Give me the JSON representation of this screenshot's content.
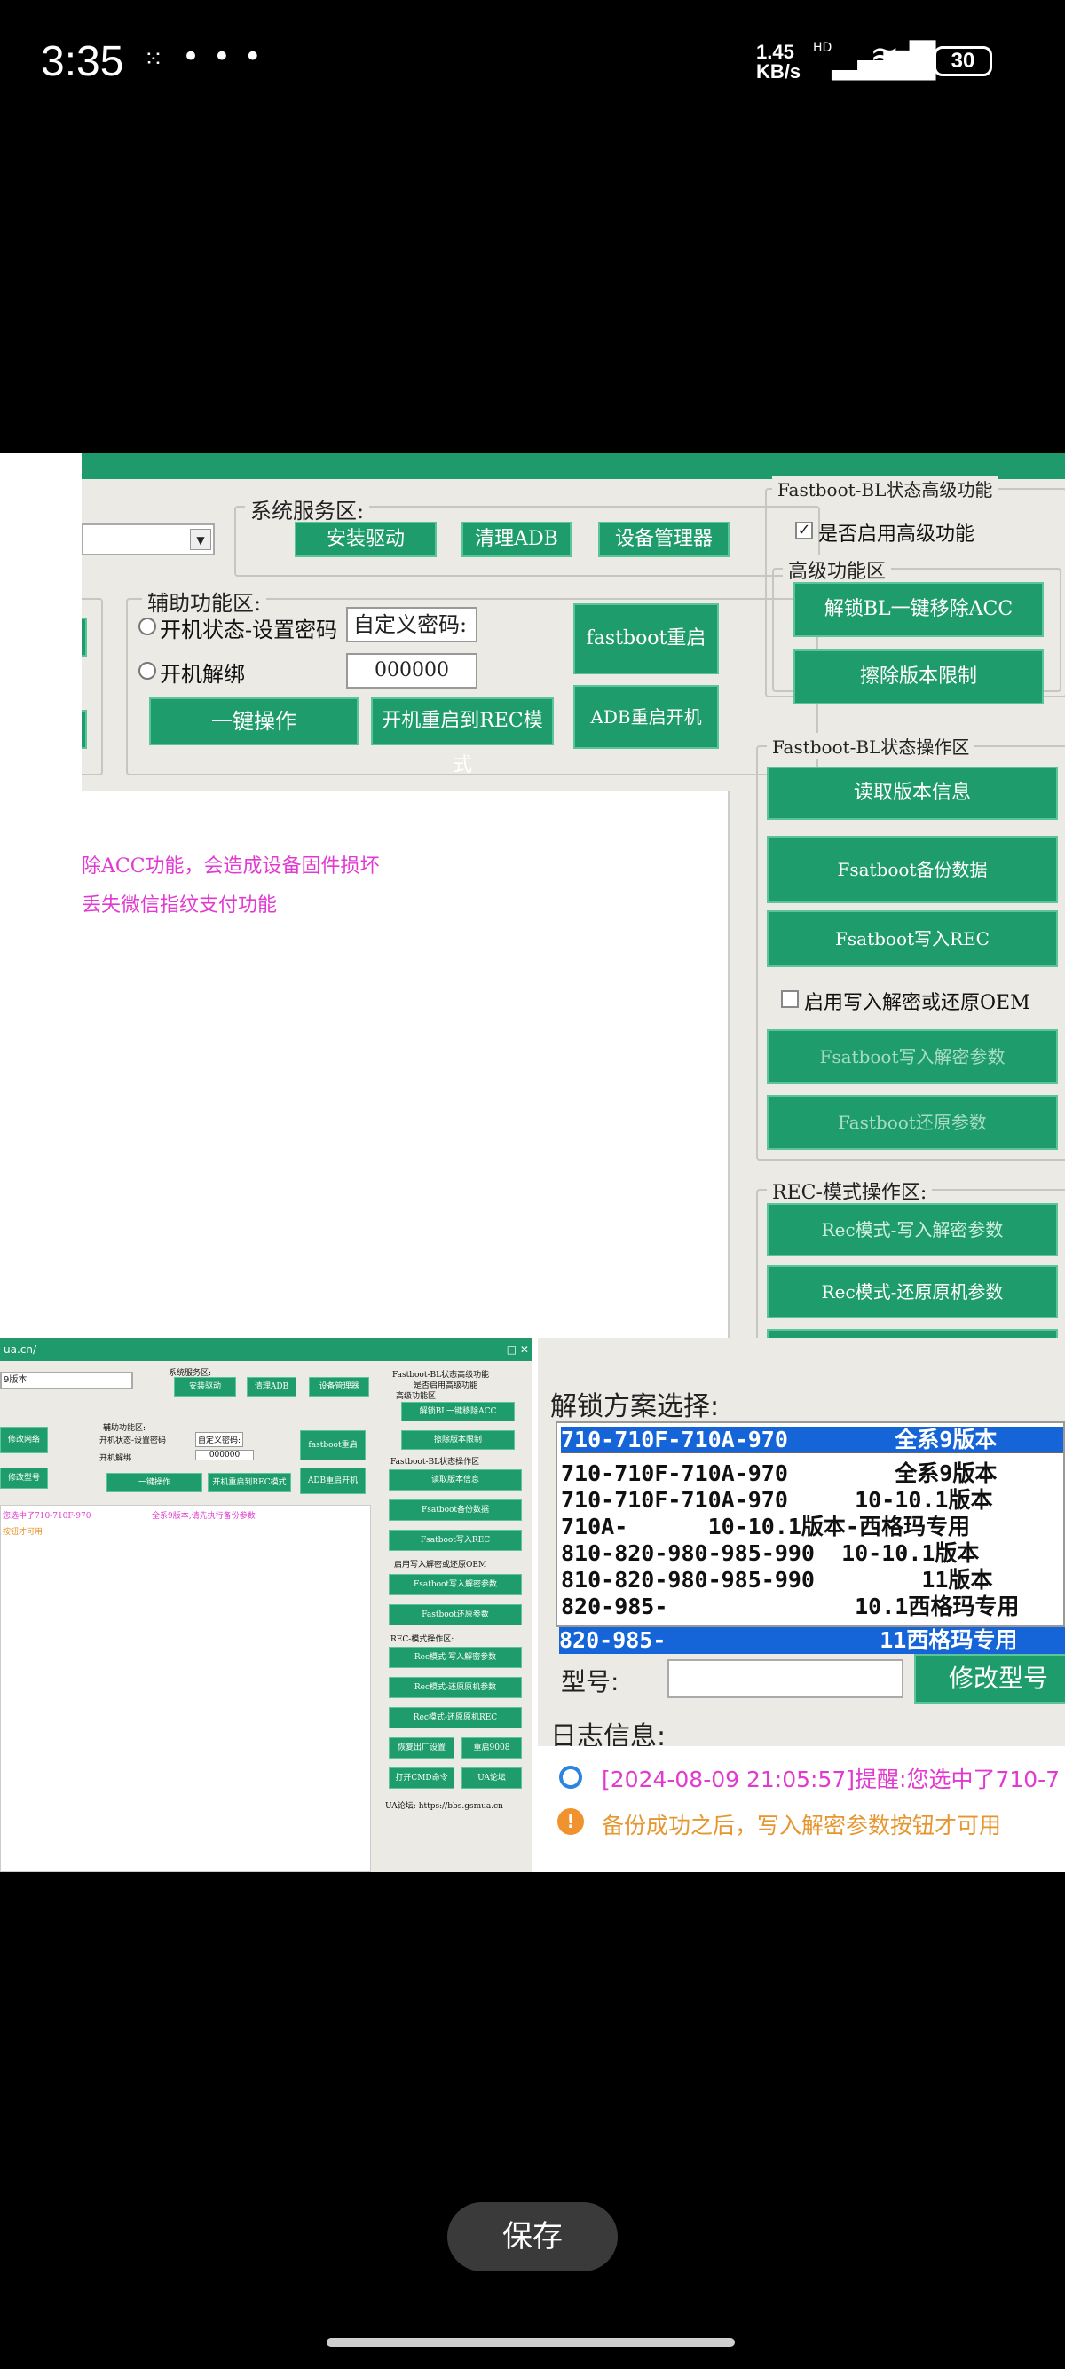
{
  "status_bar": {
    "time": "3:35",
    "notification_glyph": "⁙",
    "overflow": "• • •",
    "network_speed_value": "1.45",
    "network_speed_unit": "KB/s",
    "signal_label": "HD",
    "battery": "30"
  },
  "top_app": {
    "system_service_area": {
      "title": "系统服务区:",
      "install_driver": "安装驱动",
      "clear_adb": "清理ADB",
      "device_manager": "设备管理器"
    },
    "aux_area": {
      "title": "辅助功能区:",
      "radio_boot_password": "开机状态-设置密码",
      "custom_password_label": "自定义密码:",
      "radio_unbind": "开机解绑",
      "password_value": "000000",
      "one_click": "一键操作",
      "reboot_rec": "开机重启到REC模式",
      "fastboot_restart": "fastboot重启",
      "adb_restart": "ADB重启开机"
    },
    "fastboot_advanced": {
      "title": "Fastboot-BL状态高级功能",
      "enable_advanced": "是否启用高级功能",
      "advanced_group": "高级功能区",
      "unlock_bl_remove_acc": "解锁BL一键移除ACC",
      "erase_version_limit": "擦除版本限制"
    },
    "fastboot_ops": {
      "title": "Fastboot-BL状态操作区",
      "read_version": "读取版本信息",
      "backup_data": "Fsatboot备份数据",
      "write_rec": "Fsatboot写入REC",
      "enable_write_decrypt": "启用写入解密或还原OEM",
      "write_decrypt_params": "Fsatboot写入解密参数",
      "restore_params": "Fastboot还原参数"
    },
    "rec_ops": {
      "title": "REC-模式操作区:",
      "rec_write_decrypt": "Rec模式-写入解密参数",
      "rec_restore_params": "Rec模式-还原原机参数"
    },
    "log_lines": [
      "除ACC功能，会造成设备固件损坏",
      "丢失微信指纹支付功能"
    ]
  },
  "bottom_left_app": {
    "title_fragment": "ua.cn/",
    "combo_value": "9版本",
    "sys_title": "系统服务区:",
    "install_driver": "安装驱动",
    "clear_adb": "清理ADB",
    "device_manager": "设备管理器",
    "aux_title": "辅助功能区:",
    "radio_boot_password": "开机状态-设置密码",
    "custom_password_label": "自定义密码:",
    "radio_unbind": "开机解绑",
    "password_value": "000000",
    "fastboot_restart": "fastboot重启",
    "one_click": "一键操作",
    "reboot_rec": "开机重启到REC模式",
    "adb_restart": "ADB重启开机",
    "modify_network": "修改网络",
    "modify_model": "修改型号",
    "fb_adv_title": "Fastboot-BL状态高级功能",
    "enable_advanced": "是否启用高级功能",
    "adv_group": "高级功能区",
    "unlock_bl": "解锁BL一键移除ACC",
    "erase_limit": "擦除版本限制",
    "fb_ops_title": "Fastboot-BL状态操作区",
    "read_version": "读取版本信息",
    "backup_data": "Fsatboot备份数据",
    "write_rec": "Fsatboot写入REC",
    "enable_write": "启用写入解密或还原OEM",
    "write_decrypt": "Fsatboot写入解密参数",
    "restore": "Fastboot还原参数",
    "rec_title": "REC-模式操作区:",
    "rec_write": "Rec模式-写入解密参数",
    "rec_restore": "Rec模式-还原原机参数",
    "rec_restore2": "Rec模式-还原原机REC",
    "factory_reset": "恢复出厂设置",
    "reboot_edl": "重启9008",
    "open_cmd": "打开CMD命令",
    "forum": "UA论坛",
    "forum_url": "UA论坛: https://bbs.gsmua.cn",
    "log_line1": "您选中了710-710F-970",
    "log_line1b": "全系9版本,请先执行备份参数",
    "log_line2": "按钮才可用"
  },
  "bottom_right_zoom": {
    "unlock_scheme_title": "解锁方案选择:",
    "selected": "710-710F-710A-970        全系9版本",
    "options": [
      "710-710F-710A-970        全系9版本",
      "710-710F-710A-970     10-10.1版本",
      "710A-      10-10.1版本-西格玛专用",
      "810-820-980-985-990  10-10.1版本",
      "810-820-980-985-990        11版本",
      "820-985-              10.1西格玛专用",
      "820-985-                11西格玛专用"
    ],
    "model_label": "型号:",
    "modify_model": "修改型号",
    "log_title": "日志信息:",
    "log_line1": "[2024-08-09 21:05:57]提醒:您选中了710-7",
    "log_line2": "备份成功之后，写入解密参数按钮才可用"
  },
  "save_button": "保存",
  "colors": {
    "accent_green": "#1f9c6b",
    "magenta_text": "#e23ad1",
    "selection_blue": "#1565d8"
  }
}
